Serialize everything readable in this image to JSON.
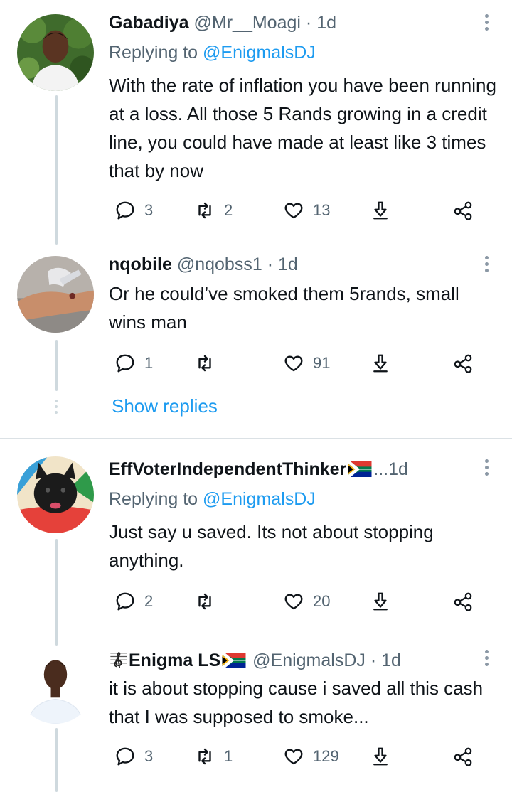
{
  "tweets": [
    {
      "name": "Gabadiya",
      "handle": "@Mr__Moagi",
      "sep": "·",
      "time": "1d",
      "replying_prefix": "Replying to ",
      "replying_to": "@EnigmalsDJ",
      "text": "With the rate of inflation you have been running at a loss. All those 5 Rands growing in a credit line, you could have made at least like 3 times that by now",
      "replies": "3",
      "retweets": "2",
      "likes": "13"
    },
    {
      "name": "nqobile",
      "handle": "@nqobss1",
      "sep": "·",
      "time": "1d",
      "text": "Or he could’ve smoked them 5rands, small wins man",
      "replies": "1",
      "retweets": "",
      "likes": "91"
    },
    {
      "name": "EffVoterIndependentThinker",
      "trunc": "...",
      "time": "1d",
      "replying_prefix": "Replying to ",
      "replying_to": "@EnigmalsDJ",
      "text": "Just say u saved. Its not about stopping anything.",
      "replies": "2",
      "retweets": "",
      "likes": "20"
    },
    {
      "name": "Enigma LS",
      "handle": "@EnigmalsDJ",
      "sep": "·",
      "time": "1d",
      "text": "it is about stopping cause i saved all this cash that I was supposed to smoke...",
      "replies": "3",
      "retweets": "1",
      "likes": "129"
    }
  ],
  "show_replies": "Show replies",
  "colors": {
    "link": "#1d9bf0",
    "secondary": "#536471",
    "line": "#cfd9de"
  },
  "icons": [
    "reply-icon",
    "retweet-icon",
    "like-icon",
    "share-icon",
    "more-icon",
    "south-africa-flag-icon",
    "music-clef-icon"
  ]
}
